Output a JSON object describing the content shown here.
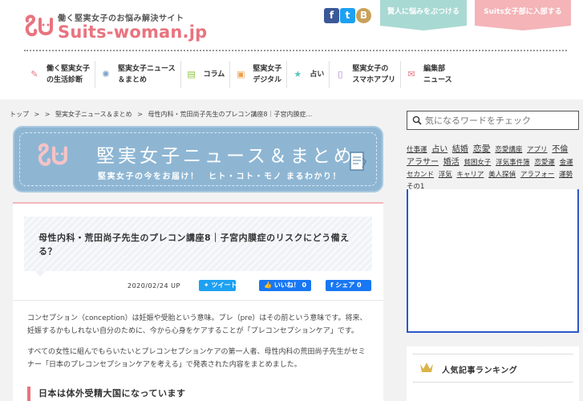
{
  "header": {
    "tagline": "働く堅実女子のお悩み解決サイト",
    "logo_text": "Suits-woman.jp",
    "social": {
      "facebook": "f",
      "twitter": "t",
      "hatena": "B"
    },
    "consult_button": "賢人に悩みをぶつける",
    "join_button": "Suits女子部に入部する"
  },
  "nav": [
    {
      "icon": "clipboard-icon",
      "label_line1": "働く堅実女子",
      "label_line2": "の生活診断"
    },
    {
      "icon": "link-icon",
      "label_line1": "堅実女子ニュース",
      "label_line2": "＆まとめ"
    },
    {
      "icon": "book-icon",
      "label_line1": "コラム",
      "label_line2": ""
    },
    {
      "icon": "bag-icon",
      "label_line1": "堅実女子",
      "label_line2": "デジタル"
    },
    {
      "icon": "star-icon",
      "label_line1": "占い",
      "label_line2": ""
    },
    {
      "icon": "phone-icon",
      "label_line1": "堅実女子の",
      "label_line2": "スマホアプリ"
    },
    {
      "icon": "chat-icon",
      "label_line1": "編集部",
      "label_line2": "ニュース"
    }
  ],
  "breadcrumb": [
    "トップ",
    ">",
    ">",
    "堅実女子ニュース＆まとめ",
    ">",
    "母性内科・荒田尚子先生のプレコン講座8｜子宮内膜症..."
  ],
  "banner": {
    "title": "堅実女子ニュース＆まとめ",
    "subtitle": "堅実女子の今をお届け！　ヒト・コト・モノ まるわかり！"
  },
  "article": {
    "title": "母性内科・荒田尚子先生のプレコン講座8｜子宮内膜症のリスクにどう備える？",
    "date": "2020/02/24 UP",
    "tweet_button": "ツイート",
    "like_button": "いいね！ 0",
    "share_button": "シェア 0",
    "paragraph1": "コンセプション（conception）は妊娠や受胎という意味。プレ（pre）はその前という意味です。将来、妊娠するかもしれない自分のために、今から心身をケアすることが「プレコンセプションケア」です。",
    "paragraph2": "すべての女性に組んでもらいたいとプレコンセプションケアの第一人者、母性内科の荒田尚子先生がセミナー「日本のプレコンセプションケアを考える」で発表された内容をまとめました。",
    "subhead": "日本は体外受精大国になっています"
  },
  "sidebar": {
    "search_placeholder": "気になるワードをチェック",
    "tags": [
      "仕事運",
      "占い",
      "結婚",
      "恋愛",
      "恋愛講座",
      "アプリ",
      "不倫",
      "アラサー",
      "婚活",
      "貧困女子",
      "浮気事件簿",
      "恋愛運",
      "金運",
      "セカンド",
      "浮気",
      "キャリア",
      "美人探偵",
      "アラフォー",
      "運勢",
      "その1"
    ],
    "ranking_title": "人気記事ランキング"
  },
  "colors": {
    "brand_pink": "#e8747f",
    "banner_blue": "#8eb6d3",
    "consult_mint": "#a9d9d3",
    "join_pink": "#f4b4b8",
    "ad_border": "#2b57c9"
  }
}
